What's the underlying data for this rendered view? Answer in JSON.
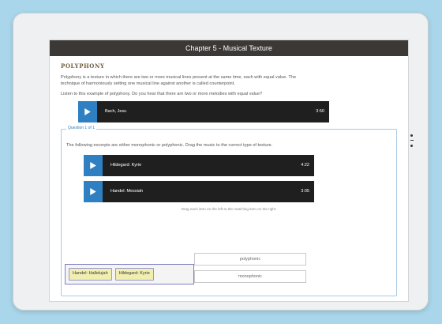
{
  "window": {
    "title": "Chapter 5 - Musical Texture"
  },
  "section": {
    "heading": "POLYPHONY",
    "paragraph1": "Polyphony is a texture in which there are two or more musical lines present at the same time, each with equal value. The technique of harmoniously setting one musical line against another is called counterpoint.",
    "paragraph2": "Listen to this example of polyphony. Do you hear that there are two or more melodies with equal value?",
    "player1": {
      "track": "Bach, Jesu",
      "time": "3:50"
    }
  },
  "question": {
    "label": "Question 1 of 1",
    "text": "The following excerpts are either monophonic or polyphonic. Drag the music to the correct type of texture.",
    "player2": {
      "track": "Hildegard: Kyrie",
      "time": "4:22"
    },
    "player3": {
      "track": "Handel: Messiah",
      "time": "3:05"
    },
    "drop_hint": "Drag each item on the left to the matching item on the right.",
    "chips": [
      "Handel: Hallelujah",
      "Hildegard: Kyrie"
    ],
    "targets": [
      "polyphonic",
      "monophonic"
    ]
  },
  "colors": {
    "accent": "#2f7fc3",
    "titlebar": "#3c3835",
    "chip": "#f1efb0"
  }
}
